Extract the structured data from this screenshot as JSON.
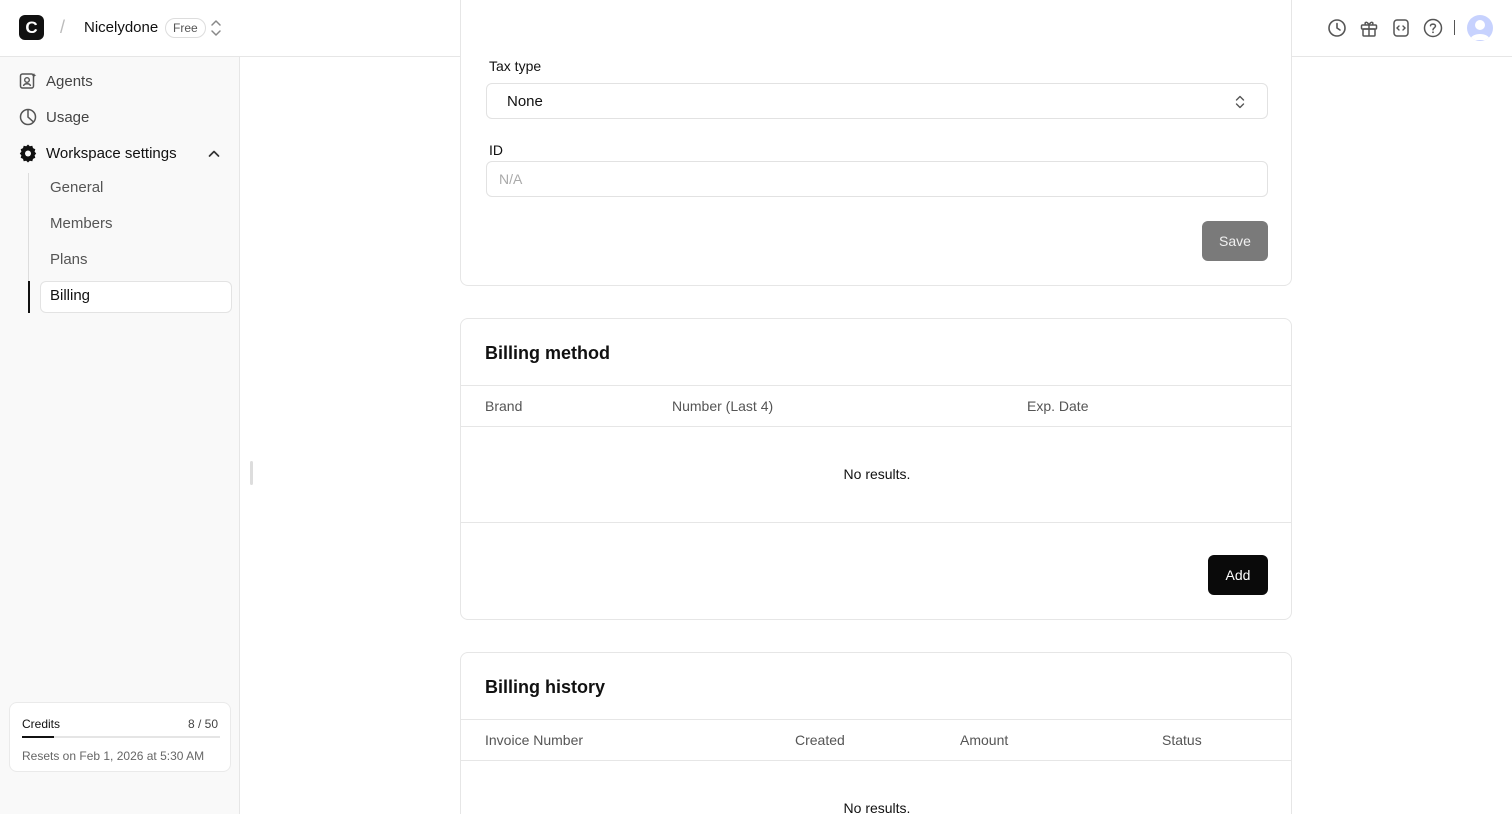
{
  "header": {
    "logo_letter": "C",
    "separator": "/",
    "workspace_name": "Nicelydone",
    "plan_badge": "Free",
    "icons": [
      "history-icon",
      "gift-icon",
      "code-icon",
      "help-icon",
      "user-avatar"
    ]
  },
  "sidebar": {
    "items": [
      {
        "label": "Agents",
        "icon": "agents-icon"
      },
      {
        "label": "Usage",
        "icon": "usage-icon"
      },
      {
        "label": "Workspace settings",
        "icon": "gear-icon"
      }
    ],
    "sub_items": [
      {
        "label": "General"
      },
      {
        "label": "Members"
      },
      {
        "label": "Plans"
      },
      {
        "label": "Billing",
        "active": true
      }
    ],
    "credits": {
      "label": "Credits",
      "value": "8 / 50",
      "used_fraction": 0.16,
      "reset_text": "Resets on Feb 1, 2026 at 5:30 AM"
    }
  },
  "tax_form": {
    "tax_type_label": "Tax type",
    "tax_type_value": "None",
    "id_label": "ID",
    "id_placeholder": "N/A",
    "save_label": "Save"
  },
  "billing_method": {
    "title": "Billing method",
    "columns": [
      "Brand",
      "Number (Last 4)",
      "Exp. Date"
    ],
    "empty_text": "No results.",
    "add_label": "Add"
  },
  "billing_history": {
    "title": "Billing history",
    "columns": [
      "Invoice Number",
      "Created",
      "Amount",
      "Status"
    ],
    "empty_text": "No results."
  },
  "colors": {
    "accent": "#0a0a0a",
    "disabled_button": "#7a7a7a",
    "sidebar_bg": "#f9f9f9",
    "border": "#e6e6e6"
  }
}
